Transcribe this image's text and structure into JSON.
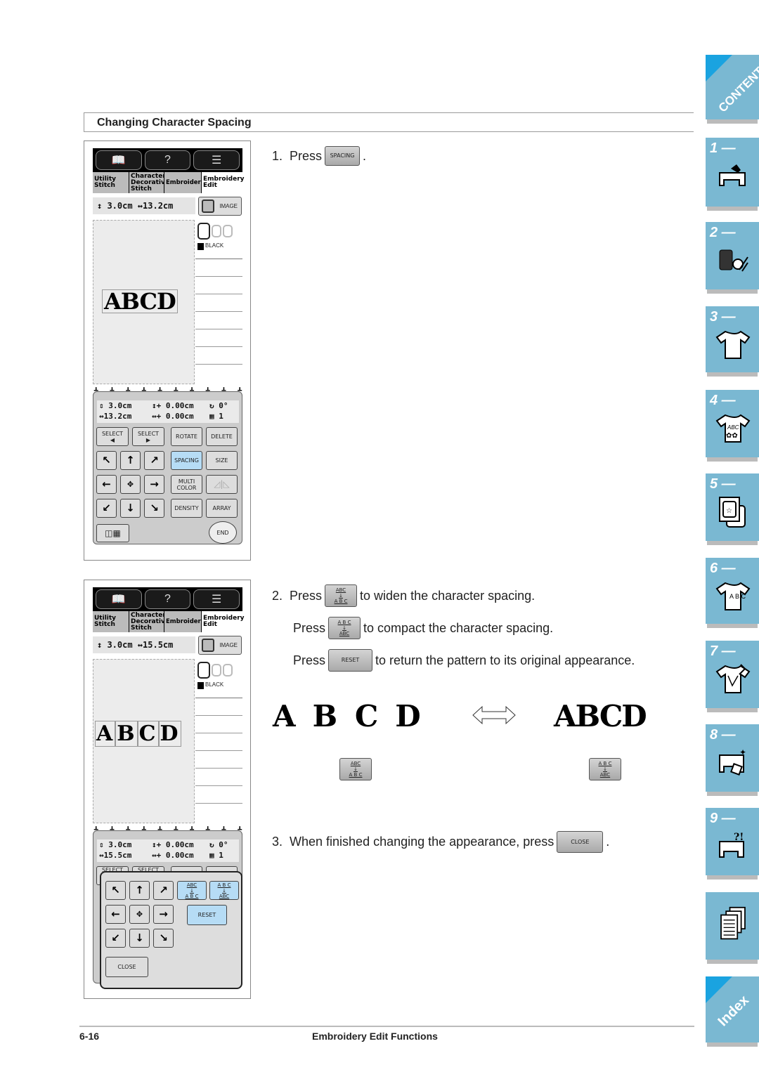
{
  "section": {
    "title": "Changing Character Spacing"
  },
  "steps": {
    "step1": {
      "num": "1.",
      "press": "Press",
      "button": "SPACING",
      "suffix": "."
    },
    "step2": {
      "num": "2.",
      "line1": {
        "press": "Press",
        "button_top": "ABC",
        "button_bottom": "A B C",
        "text": "to widen the character spacing."
      },
      "line2": {
        "press": "Press",
        "button_top": "A B C",
        "button_bottom": "ABC",
        "text": "to compact the character spacing."
      },
      "line3": {
        "press": "Press",
        "button": "RESET",
        "text": "to return the pattern to its original appearance."
      }
    },
    "step3": {
      "num": "3.",
      "text": "When finished changing the appearance, press",
      "button": "CLOSE",
      "suffix": "."
    }
  },
  "demo": {
    "wide_text": "ABCD",
    "compact_text": "ABCD",
    "wide_button": {
      "top": "ABC",
      "bottom": "A B C"
    },
    "compact_button": {
      "top": "A B C",
      "bottom": "ABC"
    }
  },
  "screen1": {
    "tabs": [
      "Utility Stitch",
      "Character Decorative Stitch",
      "Embroidery",
      "Embroidery Edit"
    ],
    "tab_lines": {
      "t1a": "Utility",
      "t1b": "Stitch",
      "t2a": "Character",
      "t2b": "Decorative",
      "t2c": "Stitch",
      "t3": "Embroidery",
      "t4a": "Embroidery",
      "t4b": "Edit"
    },
    "dims": "↕ 3.0cm ↔13.2cm",
    "image_button": "IMAGE",
    "pattern_text": "ABCD",
    "thread_color": "BLACK",
    "info": {
      "height": "3.0cm",
      "width": "13.2cm",
      "v_offset": "0.00cm",
      "h_offset": "0.00cm",
      "angle": "0°",
      "count": "1"
    },
    "buttons": {
      "select_prev": "SELECT",
      "select_next": "SELECT",
      "rotate": "ROTATE",
      "delete": "DELETE",
      "spacing": "SPACING",
      "size": "SIZE",
      "multi_color_1": "MULTI",
      "multi_color_2": "COLOR",
      "density": "DENSITY",
      "array": "ARRAY",
      "end": "END"
    }
  },
  "screen2": {
    "dims": "↕ 3.0cm ↔15.5cm",
    "image_button": "IMAGE",
    "pattern_text": "ABCD",
    "thread_color": "BLACK",
    "info": {
      "height": "3.0cm",
      "width": "15.5cm",
      "v_offset": "0.00cm",
      "h_offset": "0.00cm",
      "angle": "0°",
      "count": "1"
    },
    "buttons": {
      "select_prev": "SELECT",
      "select_next": "SELECT",
      "widen_top": "ABC",
      "widen_bottom": "A B C",
      "compact_top": "A B C",
      "compact_bottom": "ABC",
      "reset": "RESET",
      "close": "CLOSE"
    }
  },
  "footer": {
    "page": "6-16",
    "title": "Embroidery Edit Functions"
  },
  "side_tabs": {
    "contents": "CONTENTS",
    "chapters": [
      "1 —",
      "2 —",
      "3 —",
      "4 —",
      "5 —",
      "6 —",
      "7 —",
      "8 —",
      "9 —"
    ],
    "index": "Index",
    "chapter4_icon_text": "ABC",
    "chapter6_icon_text": "ABC",
    "chapter9_icon_text": "?!"
  },
  "colors": {
    "tab_blue": "#7ab8d2",
    "tab_corner": "#1aa3e0",
    "button_highlight": "#b6dcf5"
  }
}
